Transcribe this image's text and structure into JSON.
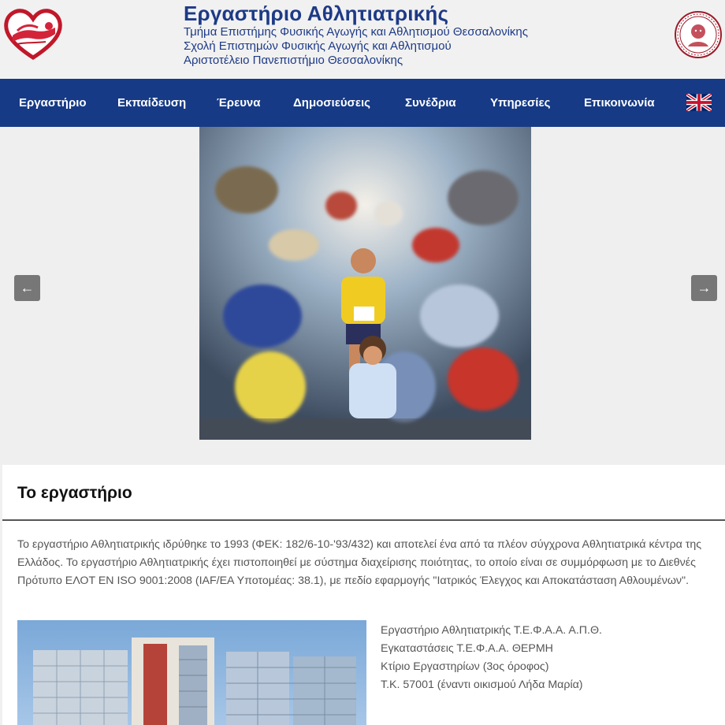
{
  "header": {
    "title": "Εργαστήριο Αθλητιατρικής",
    "line1": "Τμήμα Επιστήμης Φυσικής Αγωγής και Αθλητισμού Θεσσαλονίκης",
    "line2": "Σχολή Επιστημών Φυσικής Αγωγής και Αθλητισμού",
    "line3": "Αριστοτέλειο Πανεπιστήμιο Θεσσαλονίκης"
  },
  "nav": {
    "items": [
      "Εργαστήριο",
      "Εκπαίδευση",
      "Έρευνα",
      "Δημοσιεύσεις",
      "Συνέδρια",
      "Υπηρεσίες",
      "Επικοινωνία"
    ],
    "language_icon": "uk-flag-icon"
  },
  "slider": {
    "prev_icon": "arrow-left-icon",
    "next_icon": "arrow-right-icon",
    "prev_glyph": "←",
    "next_glyph": "→"
  },
  "section": {
    "title": "Το εργαστήριο",
    "paragraph": "Το εργαστήριο Αθλητιατρικής ιδρύθηκε το 1993 (ΦΕΚ: 182/6-10-'93/432) και αποτελεί ένα από τα πλέον σύγχρονα Αθλητιατρικά κέντρα της Ελλάδος. Το εργαστήριο Αθλητιατρικής έχει πιστοποιηθεί με σύστημα διαχείρισης ποιότητας, το οποίο είναι σε συμμόρφωση με το Διεθνές Πρότυπο ΕΛΟΤ ΕΝ ISO 9001:2008 (IAF/EA Υποτομέας: 38.1), με πεδίο εφαρμογής \"Ιατρικός Έλεγχος και Αποκατάσταση Αθλουμένων\".",
    "address": [
      "Εργαστήριο Αθλητιατρικής Τ.Ε.Φ.Α.Α. Α.Π.Θ.",
      "Εγκαταστάσεις Τ.Ε.Φ.Α.Α. ΘΕΡΜΗ",
      "Κτίριο Εργαστηρίων (3ος όροφος)",
      "Τ.Κ. 57001 (έναντι οικισμού Λήδα Μαρία)"
    ]
  },
  "colors": {
    "brand_blue": "#163a86",
    "title_blue": "#1d3a86",
    "arrow_gray": "#777777"
  }
}
